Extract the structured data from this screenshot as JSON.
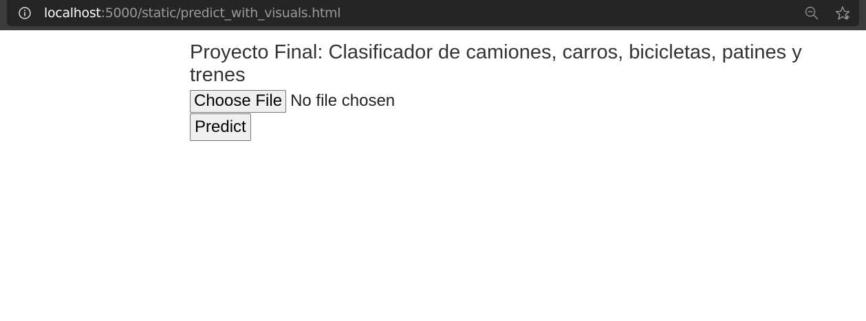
{
  "browser": {
    "url_host": "localhost",
    "url_path": ":5000/static/predict_with_visuals.html",
    "icons": [
      "info-icon",
      "zoom-out-icon",
      "star-icon"
    ]
  },
  "page": {
    "title": "Proyecto Final: Clasificador de camiones, carros, bicicletas, patines y trenes",
    "file_input": {
      "button_label": "Choose File",
      "status": "No file chosen"
    },
    "predict_label": "Predict"
  }
}
